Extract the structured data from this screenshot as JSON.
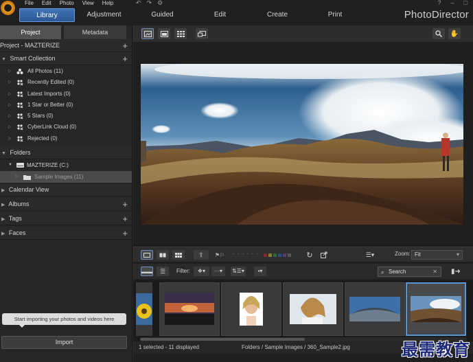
{
  "app": {
    "brand": "PhotoDirector",
    "menu": [
      "File",
      "Edit",
      "Photo",
      "View",
      "Help"
    ],
    "window_controls": [
      "?",
      "–",
      "□"
    ],
    "modes": [
      "Library",
      "Adjustment",
      "Guided",
      "Edit",
      "Create",
      "Print"
    ],
    "active_mode": "Library"
  },
  "left_panel": {
    "tabs": [
      "Project",
      "Metadata"
    ],
    "active_tab": "Project",
    "project_title": "Project - MAZTERIZE",
    "smart_collection": {
      "title": "Smart Collection",
      "items": [
        "All Photos (11)",
        "Recently Edited (0)",
        "Latest Imports (0)",
        "1 Star or Better (0)",
        "5 Stars (0)",
        "CyberLink Cloud (0)",
        "Rejected (0)"
      ]
    },
    "folders": {
      "title": "Folders",
      "drive": "MAZTERIZE (C:)",
      "subfolder": "Sample Images (11)"
    },
    "calendar_view": "Calendar View",
    "albums": "Albums",
    "tags": "Tags",
    "faces": "Faces",
    "import_hint": "Start importing your photos and videos here",
    "import_button": "Import"
  },
  "viewer": {
    "zoom_label": "Zoom:",
    "zoom_value": "Fit",
    "swatch_colors": [
      "#7a2a2a",
      "#8a7a2a",
      "#2a6a3a",
      "#2a4a7a",
      "#5a3a7a",
      "#555555"
    ]
  },
  "filter_bar": {
    "label": "Filter:",
    "search_placeholder": "Search"
  },
  "thumbnails": [
    {
      "name": "sunflower",
      "selected": false
    },
    {
      "name": "sunset",
      "selected": false
    },
    {
      "name": "laughing-woman",
      "selected": false
    },
    {
      "name": "smiling-woman",
      "selected": false
    },
    {
      "name": "panorama-1",
      "selected": false
    },
    {
      "name": "panorama-2",
      "selected": true
    }
  ],
  "status": {
    "selection": "1 selected - 11 displayed",
    "path": "Folders / Sample Images / 360_Sample2.jpg"
  },
  "watermark": "最需教育"
}
